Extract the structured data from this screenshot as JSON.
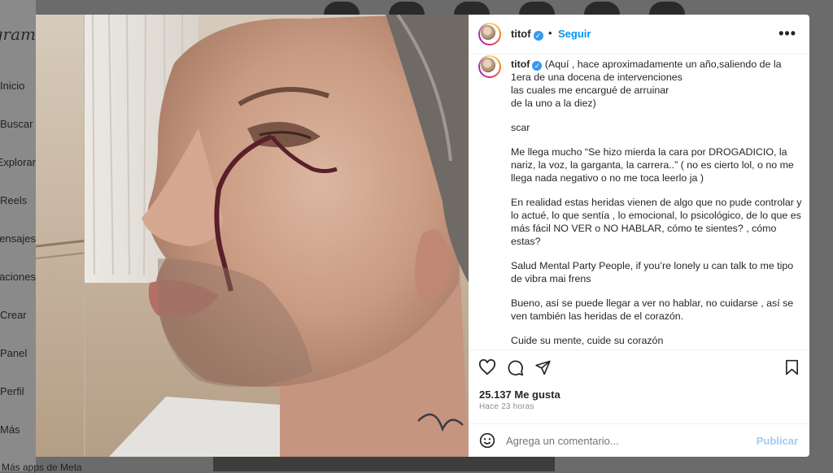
{
  "background": {
    "logo": "Instagram",
    "nav_items": [
      "Inicio",
      "Buscar",
      "Explorar",
      "Reels",
      "Mensajes",
      "Notificaciones",
      "Crear",
      "Panel",
      "Perfil",
      "Más"
    ],
    "meta_link": "Más apps de Meta"
  },
  "post": {
    "photo_description_icon": "post-photo",
    "header": {
      "username": "titof",
      "verified": true,
      "separator": "•",
      "follow_label": "Seguir",
      "more_icon": "more-horizontal-icon"
    },
    "caption": {
      "username": "titof",
      "paragraphs": [
        "(Aquí , hace aproximadamente un año,saliendo de la 1era de una docena de intervenciones\nlas cuales me encargué de arruinar\nde la uno a la diez)",
        "scar",
        "Me llega mucho “Se hizo mierda la cara por DROGADICIO, la nariz, la voz, la garganta, la carrera..” ( no es cierto lol, o no me llega nada negativo o no me toca leerlo ja )",
        "En realidad estas heridas vienen de algo que no pude controlar y lo actué, lo que sentía , lo emocional, lo psicológico, de lo que es más fácil NO VER o NO HABLAR, cómo te sientes? , cómo estas?",
        "Salud Mental Party People, if you’re lonely u can talk to me tipo de vibra mai frens",
        "Bueno, así se puede llegar a ver no hablar, no cuidarse , así se ven también las heridas de el corazón.",
        "Cuide su mente, cuide su corazón\ncuidar su cuerpo nada más es cuestión de atención y ponerse una chinga"
      ]
    },
    "actions": {
      "like_icon": "heart-icon",
      "comment_icon": "comment-icon",
      "share_icon": "share-icon",
      "save_icon": "bookmark-icon"
    },
    "likes_text": "25.137 Me gusta",
    "time_text": "Hace 23 horas",
    "comment": {
      "placeholder": "Agrega un comentario...",
      "emoji_icon": "emoji-icon",
      "publish_label": "Publicar"
    }
  },
  "colors": {
    "link_blue": "#0095f6",
    "publish_disabled": "#9ccbf6",
    "verified_blue": "#3897f0"
  }
}
